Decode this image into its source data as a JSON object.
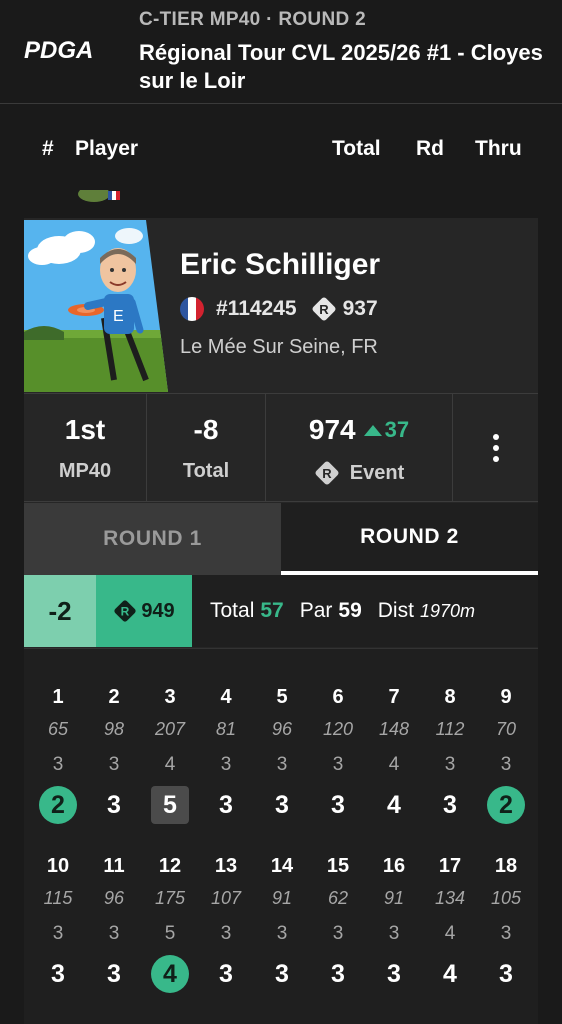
{
  "header": {
    "tier_line": "C-TIER  MP40 · ROUND 2",
    "title": "Régional Tour CVL 2025/26 #1 - Cloyes sur le Loir",
    "logo_text": "PDGA"
  },
  "columns": {
    "num": "#",
    "player": "Player",
    "total": "Total",
    "rd": "Rd",
    "thru": "Thru"
  },
  "player": {
    "name": "Eric Schilliger",
    "pdga_number": "#114245",
    "rating": "937",
    "location": "Le Mée Sur Seine, FR",
    "flag": "france-flag-icon"
  },
  "stats": {
    "place": "1st",
    "division": "MP40",
    "total": "-8",
    "total_label": "Total",
    "event_rating": "974",
    "rating_delta": "37",
    "event_label": "Event"
  },
  "tabs": [
    {
      "label": "ROUND 1",
      "active": false
    },
    {
      "label": "ROUND 2",
      "active": true
    }
  ],
  "round_summary": {
    "score": "-2",
    "round_rating": "949",
    "total_label": "Total",
    "total": "57",
    "par_label": "Par",
    "par": "59",
    "dist_label": "Dist",
    "dist": "1970m"
  },
  "holes": [
    {
      "n": "1",
      "dist": "65",
      "par": "3",
      "score": "2",
      "kind": "birdie"
    },
    {
      "n": "2",
      "dist": "98",
      "par": "3",
      "score": "3",
      "kind": "par"
    },
    {
      "n": "3",
      "dist": "207",
      "par": "4",
      "score": "5",
      "kind": "bogey"
    },
    {
      "n": "4",
      "dist": "81",
      "par": "3",
      "score": "3",
      "kind": "par"
    },
    {
      "n": "5",
      "dist": "96",
      "par": "3",
      "score": "3",
      "kind": "par"
    },
    {
      "n": "6",
      "dist": "120",
      "par": "3",
      "score": "3",
      "kind": "par"
    },
    {
      "n": "7",
      "dist": "148",
      "par": "4",
      "score": "4",
      "kind": "par"
    },
    {
      "n": "8",
      "dist": "112",
      "par": "3",
      "score": "3",
      "kind": "par"
    },
    {
      "n": "9",
      "dist": "70",
      "par": "3",
      "score": "2",
      "kind": "birdie"
    },
    {
      "n": "10",
      "dist": "115",
      "par": "3",
      "score": "3",
      "kind": "par"
    },
    {
      "n": "11",
      "dist": "96",
      "par": "3",
      "score": "3",
      "kind": "par"
    },
    {
      "n": "12",
      "dist": "175",
      "par": "5",
      "score": "4",
      "kind": "birdie"
    },
    {
      "n": "13",
      "dist": "107",
      "par": "3",
      "score": "3",
      "kind": "par"
    },
    {
      "n": "14",
      "dist": "91",
      "par": "3",
      "score": "3",
      "kind": "par"
    },
    {
      "n": "15",
      "dist": "62",
      "par": "3",
      "score": "3",
      "kind": "par"
    },
    {
      "n": "16",
      "dist": "91",
      "par": "3",
      "score": "3",
      "kind": "par"
    },
    {
      "n": "17",
      "dist": "134",
      "par": "4",
      "score": "4",
      "kind": "par"
    },
    {
      "n": "18",
      "dist": "105",
      "par": "3",
      "score": "3",
      "kind": "par"
    }
  ],
  "colors": {
    "background": "#1a1a1a",
    "card": "#262626",
    "accent_green": "#38b88a",
    "light_green": "#7dcfae"
  }
}
